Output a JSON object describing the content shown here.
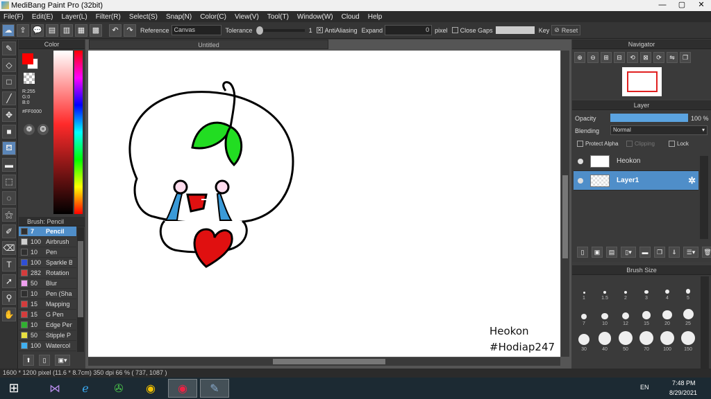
{
  "window": {
    "title": "MediBang Paint Pro (32bit)",
    "minimize": "—",
    "maximize": "▢",
    "close": "✕"
  },
  "menu": [
    "File(F)",
    "Edit(E)",
    "Layer(L)",
    "Filter(R)",
    "Select(S)",
    "Snap(N)",
    "Color(C)",
    "View(V)",
    "Tool(T)",
    "Window(W)",
    "Cloud",
    "Help"
  ],
  "toolbar": {
    "reference_label": "Reference",
    "reference_value": "Canvas",
    "tolerance_label": "Tolerance",
    "tolerance_value": "1",
    "antialiasing_label": "AntiAliasing",
    "expand_label": "Expand",
    "expand_value": "0",
    "expand_unit": "pixel",
    "close_gaps_label": "Close Gaps",
    "key_label": "Key",
    "reset_label": "Reset"
  },
  "color_panel": {
    "title": "Color",
    "r": "R:255",
    "g": "G:0",
    "b": "B:0",
    "hex": "#FF0000",
    "primary_color": "#ff0000",
    "secondary_color": "#ffffff"
  },
  "brush_panel": {
    "title": "Brush: Pencil",
    "items": [
      {
        "size": "7",
        "name": "Pencil",
        "color": "#303030"
      },
      {
        "size": "100",
        "name": "Airbrush",
        "color": "#cfcfcf"
      },
      {
        "size": "10",
        "name": "Pen",
        "color": "#303030"
      },
      {
        "size": "100",
        "name": "Sparkle B",
        "color": "#2f4fd6"
      },
      {
        "size": "282",
        "name": "Rotation",
        "color": "#d43c3c"
      },
      {
        "size": "50",
        "name": "Blur",
        "color": "#f0a0f0"
      },
      {
        "size": "10",
        "name": "Pen (Sha",
        "color": "#303030"
      },
      {
        "size": "15",
        "name": "Mapping",
        "color": "#d43c3c"
      },
      {
        "size": "15",
        "name": "G Pen",
        "color": "#d43c3c"
      },
      {
        "size": "10",
        "name": "Edge Pen",
        "color": "#30b030"
      },
      {
        "size": "50",
        "name": "Stipple P",
        "color": "#e8e040"
      },
      {
        "size": "100",
        "name": "Watercol",
        "color": "#40b0f0"
      }
    ]
  },
  "document": {
    "tab_title": "Untitled"
  },
  "canvas": {
    "signature_name": "Heokon",
    "signature_tag": "#Hodiap247"
  },
  "navigator": {
    "title": "Navigator"
  },
  "layer_panel": {
    "title": "Layer",
    "opacity_label": "Opacity",
    "opacity_value": "100 %",
    "opacity_fraction": 1.0,
    "blending_label": "Blending",
    "blending_value": "Normal",
    "protect_alpha_label": "Protect Alpha",
    "clipping_label": "Clipping",
    "lock_label": "Lock",
    "layers": [
      {
        "name": "Heokon",
        "selected": false
      },
      {
        "name": "Layer1",
        "selected": true
      }
    ]
  },
  "brush_size_panel": {
    "title": "Brush Size",
    "sizes": [
      "1",
      "1.5",
      "2",
      "3",
      "4",
      "5",
      "7",
      "10",
      "12",
      "15",
      "20",
      "25",
      "30",
      "40",
      "50",
      "70",
      "100",
      "150"
    ]
  },
  "status": {
    "text": "1600 * 1200 pixel   (11.6 * 8.7cm)   350 dpi   66 %   ( 737, 1087 )"
  },
  "taskbar": {
    "language": "EN",
    "time": "7:48 PM",
    "date": "8/29/2021"
  }
}
